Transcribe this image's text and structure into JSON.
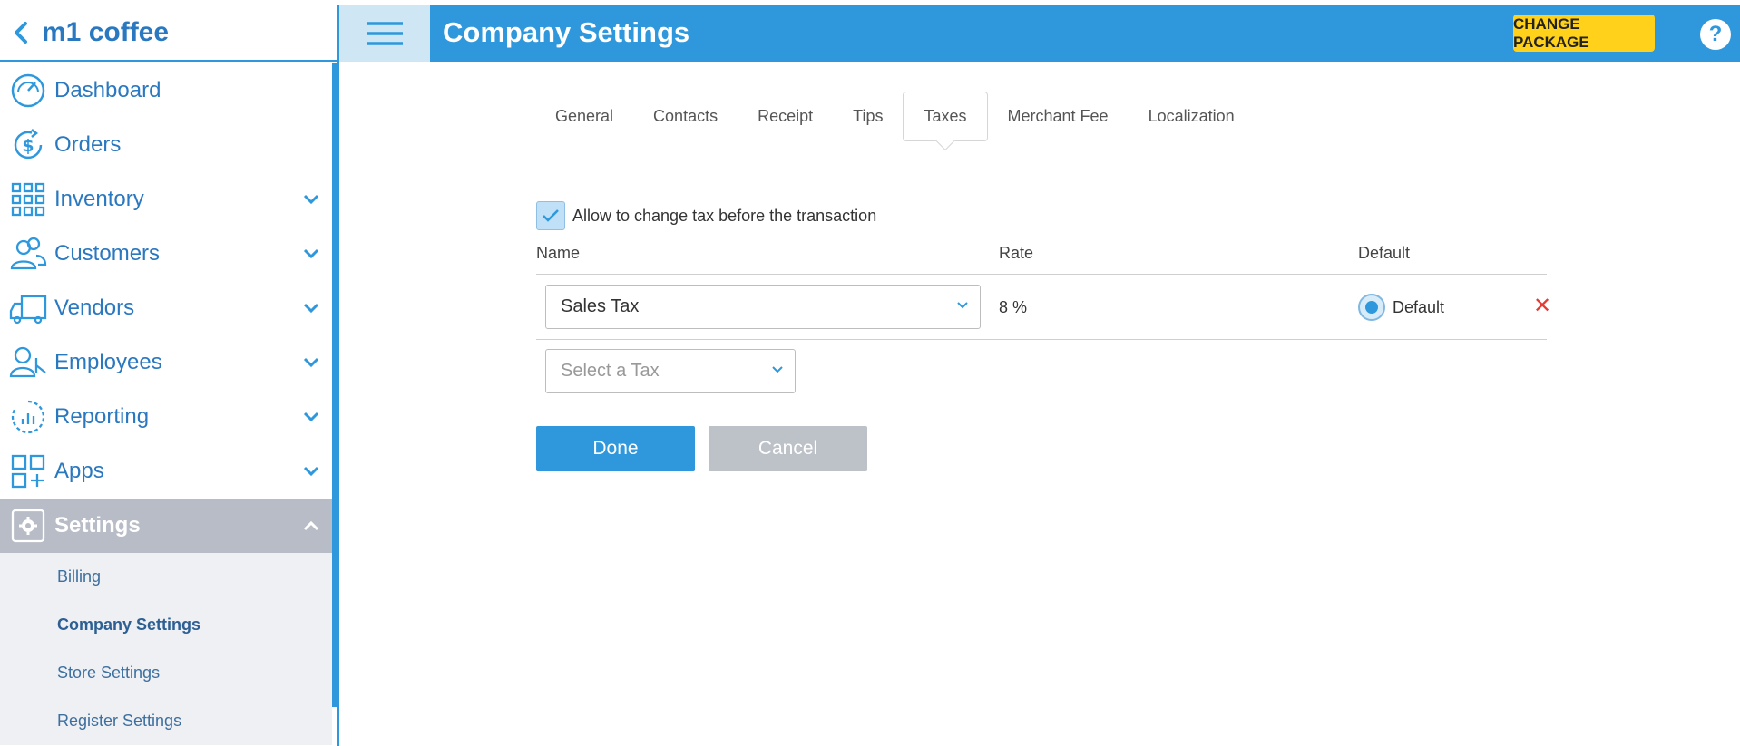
{
  "sidebar": {
    "brand": "m1 coffee",
    "items": [
      {
        "label": "Dashboard"
      },
      {
        "label": "Orders"
      },
      {
        "label": "Inventory"
      },
      {
        "label": "Customers"
      },
      {
        "label": "Vendors"
      },
      {
        "label": "Employees"
      },
      {
        "label": "Reporting"
      },
      {
        "label": "Apps"
      },
      {
        "label": "Settings"
      }
    ],
    "sub_items": [
      {
        "label": "Billing"
      },
      {
        "label": "Company Settings"
      },
      {
        "label": "Store Settings"
      },
      {
        "label": "Register Settings"
      }
    ]
  },
  "header": {
    "title": "Company Settings",
    "change_package": "CHANGE PACKAGE",
    "help": "?"
  },
  "tabs": [
    {
      "label": "General"
    },
    {
      "label": "Contacts"
    },
    {
      "label": "Receipt"
    },
    {
      "label": "Tips"
    },
    {
      "label": "Taxes"
    },
    {
      "label": "Merchant Fee"
    },
    {
      "label": "Localization"
    }
  ],
  "taxes": {
    "allow_change_label": "Allow to change tax before the transaction",
    "allow_change_checked": true,
    "columns": {
      "name": "Name",
      "rate": "Rate",
      "default": "Default"
    },
    "rows": [
      {
        "name": "Sales Tax",
        "rate": "8 %",
        "default_label": "Default",
        "is_default": true
      }
    ],
    "select_placeholder": "Select a Tax",
    "done_label": "Done",
    "cancel_label": "Cancel"
  },
  "colors": {
    "accent": "#2f98dc",
    "package_button": "#ffd11a",
    "delete": "#e53b34"
  }
}
